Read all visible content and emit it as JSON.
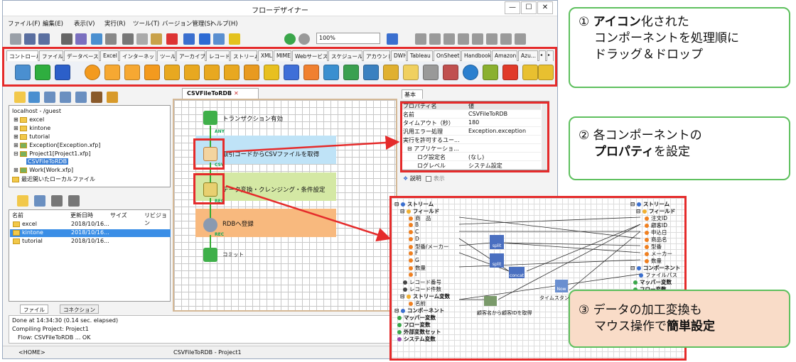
{
  "window": {
    "title": "フローデザイナー",
    "controls": [
      "—",
      "☐",
      "✕"
    ]
  },
  "menu": [
    "ファイル(F)",
    "編集(E)",
    "表示(V)",
    "実行(R)",
    "ツール(T)",
    "バージョン管理(S)",
    "ヘルプ(H)"
  ],
  "toolbar": {
    "zoom_value": "100%"
  },
  "palette_tabs": [
    "コントロール",
    "ファイル",
    "データベース",
    "Excel",
    "インターネット",
    "ツール",
    "アーカイブ",
    "レコード",
    "ストリーム",
    "XML",
    "MIME",
    "Webサービス",
    "スケジュール",
    "アカウント",
    "DWH",
    "Tableau",
    "OnSheet",
    "Handbook",
    "Amazon",
    "Azu..."
  ],
  "tree": [
    "localhost - /guest",
    "excel",
    "kintone",
    "tutorial",
    "Exception[Exception.xfp]",
    "Project1[Project1.xfp]",
    "CSVFileToRDB",
    "Work[Work.xfp]",
    "最近開いたローカルファイル"
  ],
  "file_table": {
    "headers": [
      "名前",
      "更新日時",
      "サイズ",
      "リビジョン"
    ],
    "rows": [
      {
        "name": "excel",
        "date": "2018/10/16..."
      },
      {
        "name": "kintone",
        "date": "2018/10/16..."
      },
      {
        "name": "tutorial",
        "date": "2018/10/16..."
      }
    ]
  },
  "left_tabs": [
    "ファイル",
    "コネクション"
  ],
  "log": [
    "Done at 14:34:30 (0.14 sec. elapsed)",
    "Compiling Project: Project1",
    "Flow: CSVFileToRDB ... OK"
  ],
  "status": {
    "left": "<HOME>",
    "center": "CSVFileToRDB - Project1"
  },
  "canvas": {
    "tab": "CSVFileToRDB",
    "nodes": [
      {
        "label": "トランザクション有効"
      },
      {
        "label": "取引コードからCSVファイルを取得"
      },
      {
        "label": "データ変換・クレンジング・条件設定"
      },
      {
        "label": "RDBへ登録"
      },
      {
        "label": "コミット"
      }
    ],
    "conn_labels": [
      "ANY",
      "CSV",
      "REC",
      "REC"
    ]
  },
  "props": {
    "tab": "基本",
    "col_key": "プロパティ名",
    "col_val": "値",
    "rows": [
      {
        "k": "名前",
        "v": "CSVFileToRDB"
      },
      {
        "k": "タイムアウト（秒）",
        "v": "180"
      },
      {
        "k": "汎用エラー処理",
        "v": "Exception.exception"
      },
      {
        "k": "実行を許可するユー...",
        "v": ""
      },
      {
        "k": "⊟ アプリケーショ...",
        "v": ""
      },
      {
        "k": "ログ設定名",
        "v": "(なし)"
      },
      {
        "k": "ログレベル",
        "v": "システム設定"
      }
    ],
    "desc_label": "説明",
    "desc_check": "表示"
  },
  "mapper": {
    "left": [
      "ストリーム",
      "フィールド",
      "商　品",
      "B",
      "C",
      "D",
      "型番/メーカー",
      "F",
      "G",
      "数量",
      "I",
      "レコード番号",
      "レコード件数",
      "ストリーム変数",
      "名前",
      "コンポーネント",
      "マッパー変数",
      "フロー変数",
      "外部変数セット",
      "システム変数"
    ],
    "right": [
      "ストリーム",
      "フィールド",
      "注文ID",
      "顧客ID",
      "申込日",
      "商品名",
      "型番",
      "メーカー",
      "数量",
      "コンポーネント",
      "ファイルパス",
      "マッパー変数",
      "フロー変数"
    ],
    "funcs": [
      "split",
      "split",
      "concat",
      "Now"
    ],
    "func_notes": [
      "顧客名から顧客IDを取得",
      "タイムスタンプを"
    ]
  },
  "callouts": [
    {
      "l1": "① ",
      "b1": "アイコン",
      "l1b": "化された",
      "l2": "コンポーネントを処理順に",
      "l3": "ドラッグ＆ドロップ"
    },
    {
      "l1": "② 各コンポーネントの",
      "b2": "プロパティ",
      "l2b": "を設定"
    },
    {
      "l1": "③ データの加工変換も",
      "l2": "マウス操作で",
      "b2": "簡単設定"
    }
  ],
  "colors": {
    "accent_red": "#e52b2b",
    "callout_green": "#5ec05e",
    "callout_peach": "#f9dcc8"
  }
}
